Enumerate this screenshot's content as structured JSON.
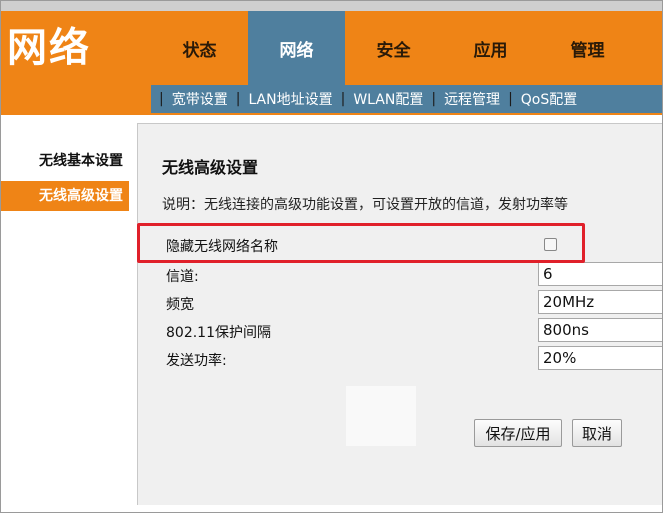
{
  "header": {
    "brand": "网络",
    "tabs": [
      "状态",
      "网络",
      "安全",
      "应用",
      "管理"
    ],
    "active_tab": 1
  },
  "subnav": {
    "items": [
      "宽带设置",
      "LAN地址设置",
      "WLAN配置",
      "远程管理",
      "QoS配置"
    ]
  },
  "sidebar": {
    "items": [
      {
        "label": "无线基本设置"
      },
      {
        "label": "无线高级设置"
      }
    ]
  },
  "panel": {
    "title": "无线高级设置",
    "description": "说明：无线连接的高级功能设置，可设置开放的信道，发射功率等"
  },
  "form": {
    "hide_ssid_label": "隐藏无线网络名称",
    "channel_label": "信道:",
    "channel_value": "6",
    "bandwidth_label": "频宽",
    "bandwidth_value": "20MHz",
    "guard_interval_label": "802.11保护间隔",
    "guard_interval_value": "800ns",
    "power_label": "发送功率:",
    "power_value": "20%"
  },
  "buttons": {
    "save_apply": "保存/应用",
    "cancel": "取消"
  },
  "colors": {
    "orange": "#ef8416",
    "blue": "#4f7f9e",
    "highlight": "#e0202a"
  }
}
